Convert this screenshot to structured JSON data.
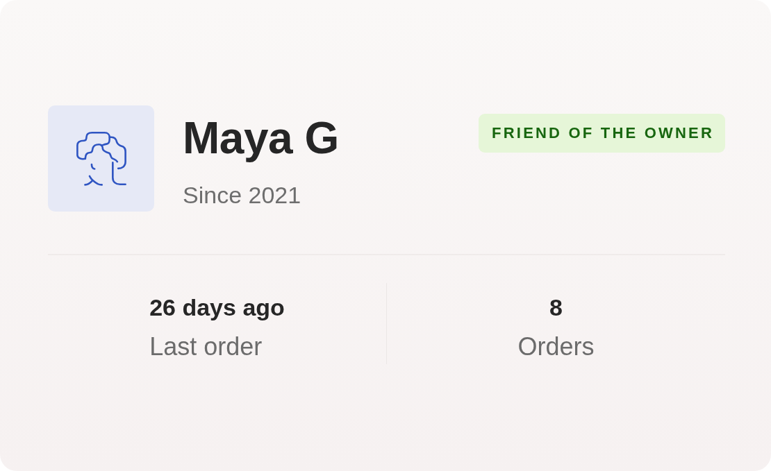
{
  "customer": {
    "name": "Maya G",
    "since": "Since 2021",
    "badge": "FRIEND OF THE OWNER"
  },
  "stats": [
    {
      "value": "26 days ago",
      "label": "Last order"
    },
    {
      "value": "8",
      "label": "Orders"
    }
  ]
}
